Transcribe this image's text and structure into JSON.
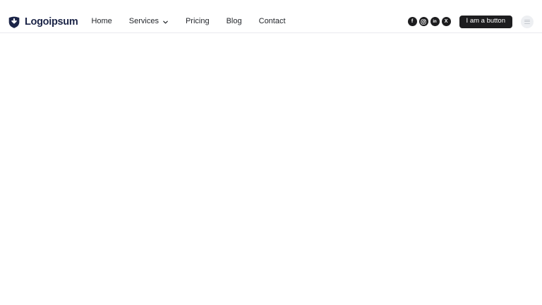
{
  "header": {
    "logo": {
      "text": "Logoipsum",
      "icon": "shield-arrow-icon",
      "color": "#1b2447"
    },
    "nav": {
      "items": [
        {
          "label": "Home",
          "has_dropdown": false
        },
        {
          "label": "Services",
          "has_dropdown": true
        },
        {
          "label": "Pricing",
          "has_dropdown": false
        },
        {
          "label": "Blog",
          "has_dropdown": false
        },
        {
          "label": "Contact",
          "has_dropdown": false
        }
      ]
    },
    "social_links": [
      {
        "name": "facebook",
        "icon": "facebook-icon",
        "glyph": "f"
      },
      {
        "name": "instagram",
        "icon": "instagram-icon"
      },
      {
        "name": "linkedin",
        "icon": "linkedin-icon",
        "glyph": "in"
      },
      {
        "name": "x",
        "icon": "x-icon",
        "glyph": "X"
      }
    ],
    "cta": {
      "label": "I am a button"
    },
    "menu_button": {
      "icon": "hamburger-icon"
    }
  },
  "colors": {
    "brand_navy": "#1b2447",
    "nav_text": "#23262b",
    "social_circle_bg": "#1d1d1f",
    "cta_bg": "#1d1d1f",
    "cta_text": "#ffffff",
    "header_border": "#e9eaee",
    "muted_circle_bg": "#edeff2",
    "muted_circle_icon": "#c5c9cf",
    "page_bg": "#ffffff"
  }
}
